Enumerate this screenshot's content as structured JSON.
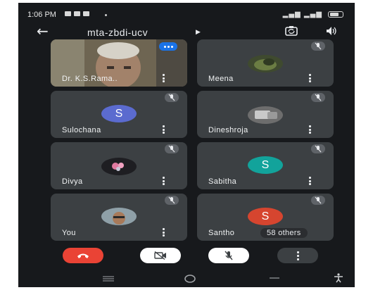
{
  "status_bar": {
    "time": "1:06 PM",
    "notification_icons": [
      "notification-icon",
      "notification-icon",
      "notification-icon"
    ],
    "signal": "4G",
    "battery": "battery-icon"
  },
  "header": {
    "meeting_code": "mta-zbdi-ucv",
    "back_icon": "back-arrow-icon",
    "caret_icon": "triangle-right-icon",
    "camera_switch_icon": "camera-switch-icon",
    "speaker_icon": "speaker-icon"
  },
  "participants": [
    {
      "name": "Dr. K.S.Rama..",
      "state": "video-speaking"
    },
    {
      "name": "Meena",
      "state": "photo-muted"
    },
    {
      "name": "Sulochana",
      "state": "initial-muted",
      "initial": "S",
      "color": "#5b6bcf"
    },
    {
      "name": "Dineshroja",
      "state": "photo-muted"
    },
    {
      "name": "Divya",
      "state": "photo-muted"
    },
    {
      "name": "Sabitha",
      "state": "initial-muted",
      "initial": "S",
      "color": "#12a39b"
    },
    {
      "name": "You",
      "state": "photo-muted"
    },
    {
      "name": "Santho",
      "state": "initial-muted",
      "initial": "S",
      "color": "#d6452f"
    }
  ],
  "others": {
    "label": "58 others"
  },
  "controls": [
    {
      "name": "end-call",
      "icon": "end-call-icon",
      "color": "#ea4335"
    },
    {
      "name": "camera-off",
      "icon": "video-off-icon",
      "color": "#ffffff"
    },
    {
      "name": "mic-off",
      "icon": "mic-off-icon",
      "color": "#ffffff"
    },
    {
      "name": "more-options",
      "icon": "more-vert-icon",
      "color": "#3c4043"
    }
  ],
  "nav_bar": {
    "icons": [
      "menu-icon",
      "home-icon",
      "back-icon",
      "accessibility-icon"
    ]
  }
}
